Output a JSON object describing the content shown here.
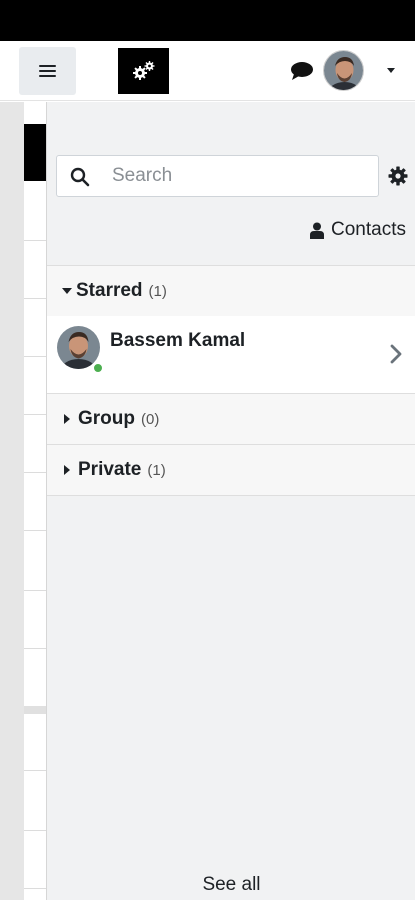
{
  "navbar": {
    "menu_icon": "hamburger-menu-icon",
    "logo_icon": "gears-logo-icon",
    "message_icon": "speech-bubble-icon",
    "user_menu_icon": "caret-down-icon"
  },
  "drawer": {
    "search": {
      "placeholder": "Search",
      "value": ""
    },
    "contacts_label": "Contacts",
    "sections": {
      "starred": {
        "label": "Starred",
        "count": "(1)"
      },
      "group": {
        "label": "Group",
        "count": "(0)"
      },
      "private": {
        "label": "Private",
        "count": "(1)"
      }
    },
    "starred_contacts": [
      {
        "name": "Bassem Kamal",
        "status": "online",
        "status_color": "#4caf50"
      }
    ],
    "see_all_label": "See all"
  },
  "colors": {
    "drawer_bg": "#f1f2f3",
    "accent_dark": "#1d2125"
  }
}
